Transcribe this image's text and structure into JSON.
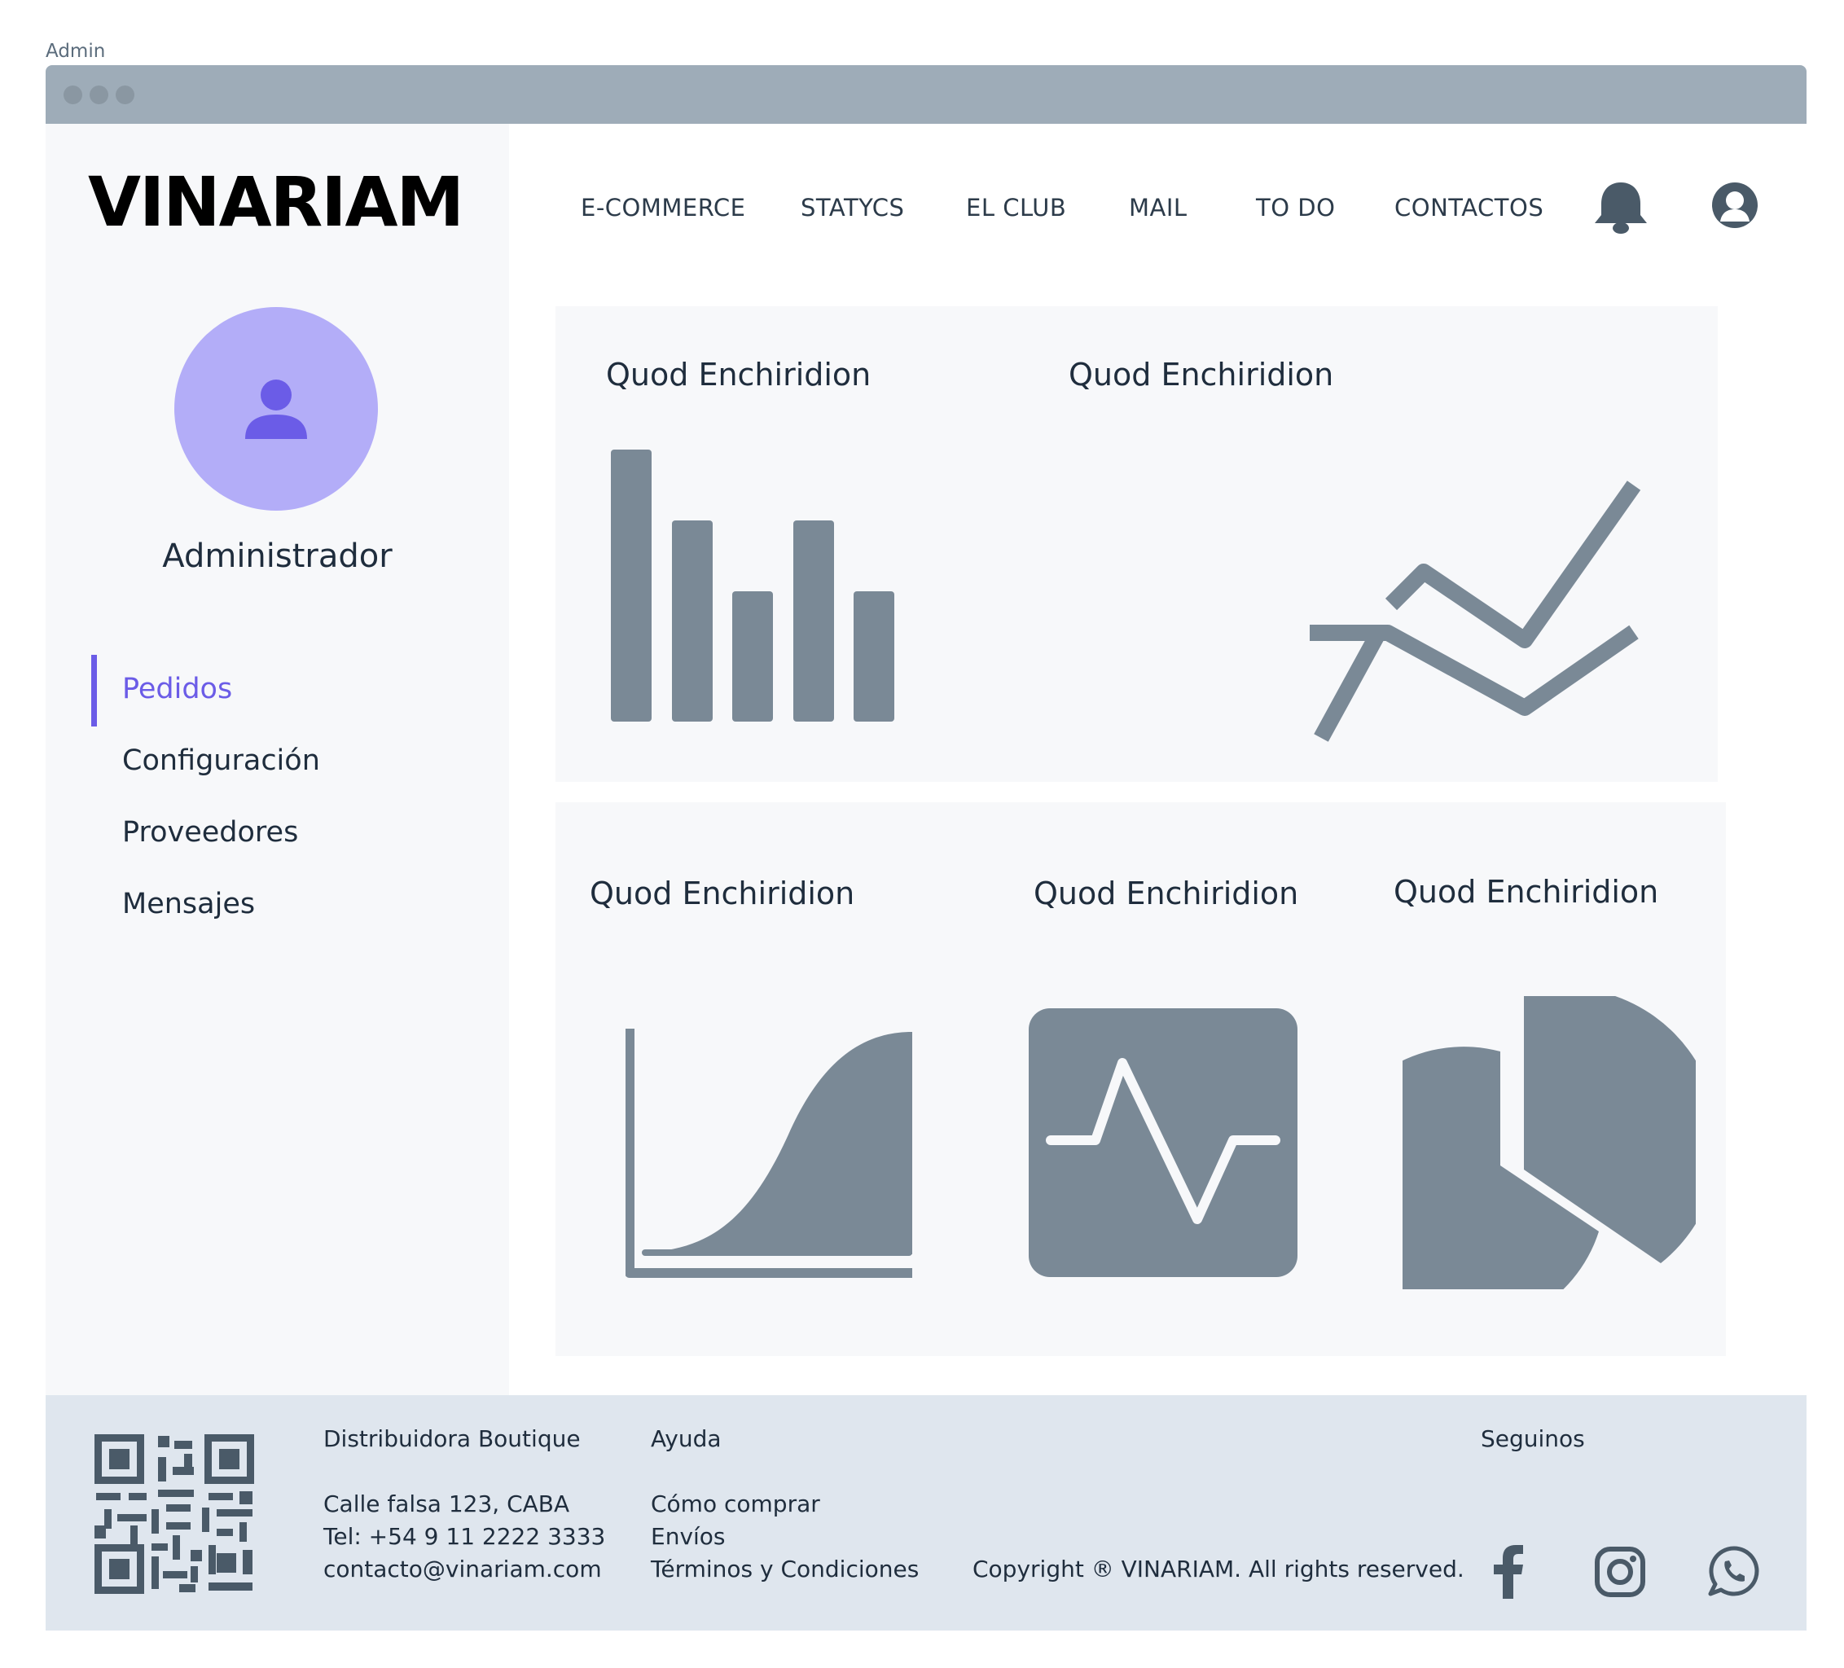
{
  "page_label": "Admin",
  "brand": {
    "logo_text": "VINARIAM"
  },
  "sidebar": {
    "user_name": "Administrador",
    "items": [
      {
        "label": "Pedidos",
        "active": true
      },
      {
        "label": "Configuración",
        "active": false
      },
      {
        "label": "Proveedores",
        "active": false
      },
      {
        "label": "Mensajes",
        "active": false
      }
    ]
  },
  "topnav": {
    "items": [
      "E-COMMERCE",
      "STATYCS",
      "EL CLUB",
      "MAIL",
      "TO DO",
      "CONTACTOS"
    ],
    "icons": [
      "bell-icon",
      "user-circle-icon"
    ]
  },
  "dashboard": {
    "cards": [
      {
        "title": "Quod Enchiridion",
        "icon": "bar-chart-icon"
      },
      {
        "title": "Quod Enchiridion",
        "icon": "line-chart-icon"
      },
      {
        "title": "Quod Enchiridion",
        "icon": "area-chart-icon"
      },
      {
        "title": "Quod Enchiridion",
        "icon": "pulse-chart-icon"
      },
      {
        "title": "Quod Enchiridion",
        "icon": "pie-chart-icon"
      }
    ]
  },
  "footer": {
    "company": "Distribuidora Boutique",
    "address": "Calle falsa 123, CABA",
    "phone": "Tel: +54 9 11 2222 3333",
    "email": "contacto@vinariam.com",
    "help_title": "Ayuda",
    "help_links": [
      "Cómo comprar",
      "Envíos",
      "Términos y Condiciones"
    ],
    "copyright": "Copyright ® VINARIAM. All rights reserved.",
    "social_title": "Seguinos",
    "social_icons": [
      "facebook-icon",
      "instagram-icon",
      "whatsapp-icon"
    ]
  },
  "colors": {
    "accent": "#6b5ce7",
    "avatar_bg": "#b3adf8",
    "chart_gray": "#7a8996",
    "footer_bg": "#dfe6ee",
    "titlebar": "#9eacb8"
  }
}
